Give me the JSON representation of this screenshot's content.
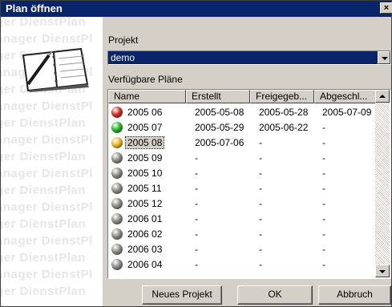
{
  "window": {
    "title": "Plan öffnen",
    "close_glyph": "×"
  },
  "sidebar": {
    "watermark_lines": [
      "ger DienstPlan",
      "anager DienstPl",
      "ger DienstPlan",
      "anager DienstPl",
      "ger DienstPlan",
      "anager DienstPl",
      "ger DienstPlan",
      "anager DienstPl",
      "ger DienstPlan",
      "anager DienstPl",
      "ger DienstPlan",
      "anager DienstPl",
      "ger DienstPlan",
      "anager DienstPl",
      "ger DienstPlan",
      "anager DienstPl",
      "ger DienstPlan"
    ],
    "logo_icon": "planner-notebook-icon"
  },
  "project": {
    "label": "Projekt",
    "value": "demo"
  },
  "plans": {
    "label": "Verfügbare Pläne",
    "columns": [
      "Name",
      "Erstellt",
      "Freigegeb...",
      "Abgeschl..."
    ],
    "rows": [
      {
        "name": "2005 06",
        "created": "2005-05-08",
        "released": "2005-05-28",
        "closed": "2005-07-09",
        "status": "red"
      },
      {
        "name": "2005 07",
        "created": "2005-05-29",
        "released": "2005-06-22",
        "closed": "-",
        "status": "green"
      },
      {
        "name": "2005 08",
        "created": "2005-07-06",
        "released": "-",
        "closed": "-",
        "status": "yellow"
      },
      {
        "name": "2005 09",
        "created": "-",
        "released": "-",
        "closed": "-",
        "status": "gray"
      },
      {
        "name": "2005 10",
        "created": "-",
        "released": "-",
        "closed": "-",
        "status": "gray"
      },
      {
        "name": "2005 11",
        "created": "-",
        "released": "-",
        "closed": "-",
        "status": "gray"
      },
      {
        "name": "2005 12",
        "created": "-",
        "released": "-",
        "closed": "-",
        "status": "gray"
      },
      {
        "name": "2006 01",
        "created": "-",
        "released": "-",
        "closed": "-",
        "status": "gray"
      },
      {
        "name": "2006 02",
        "created": "-",
        "released": "-",
        "closed": "-",
        "status": "gray"
      },
      {
        "name": "2006 03",
        "created": "-",
        "released": "-",
        "closed": "-",
        "status": "gray"
      },
      {
        "name": "2006 04",
        "created": "-",
        "released": "-",
        "closed": "-",
        "status": "gray"
      }
    ],
    "selected_name": "2005 08"
  },
  "status_colors": {
    "red": "#d42a1c",
    "green": "#22b322",
    "yellow": "#f2b21c",
    "gray": "#8a8a8a"
  },
  "buttons": {
    "new_project": "Neues Projekt",
    "ok": "OK",
    "cancel": "Abbruch"
  }
}
